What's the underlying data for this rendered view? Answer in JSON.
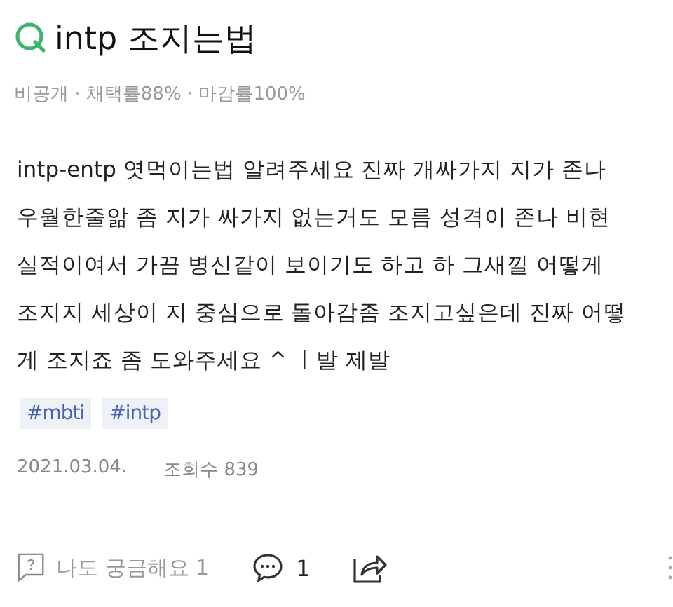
{
  "question": {
    "title": "intp 조지는법",
    "meta": "비공개 · 채택률88% · 마감률100%",
    "body_lines": [
      "intp-entp 엿먹이는법 알려주세요 진짜 개싸가지 지가 존나",
      "우월한줄앎 좀 지가 싸가지 없는거도 모름 성격이 존나 비현",
      "실적이여서 가끔 병신같이 보이기도 하고 하 그새낄 어떻게",
      "조지지 세상이 지 중심으로 돌아감좀 조지고싶은데 진짜 어떻",
      "게 조지죠 좀 도와주세요 ^ ㅣ발 제발"
    ],
    "tags": [
      "#mbti",
      "#intp"
    ],
    "date": "2021.03.04.",
    "views": "조회수 839"
  },
  "actions": {
    "curious": "나도 궁금해요 1",
    "comments": "1"
  }
}
